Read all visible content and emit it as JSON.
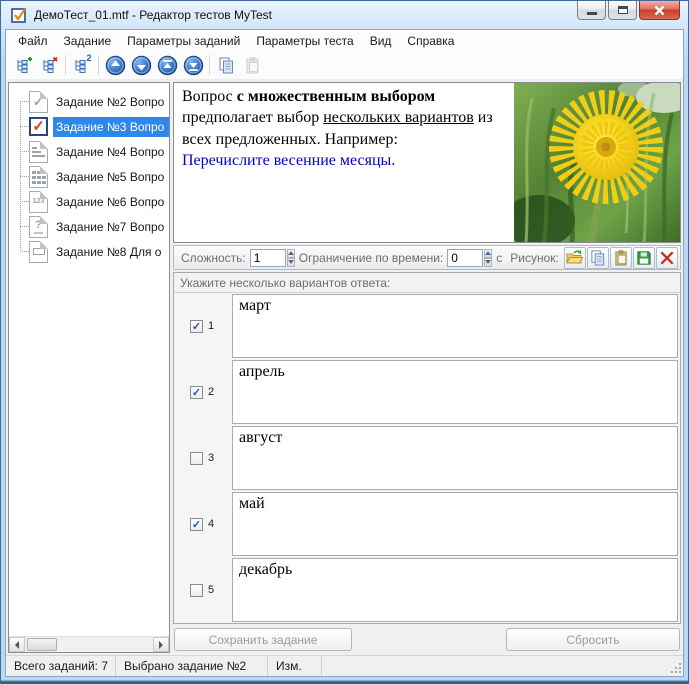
{
  "window": {
    "title": "ДемоТест_01.mtf - Редактор тестов MyTest"
  },
  "menu": {
    "items": [
      "Файл",
      "Задание",
      "Параметры заданий",
      "Параметры теста",
      "Вид",
      "Справка"
    ]
  },
  "toolbar": {
    "duplicate_badge": "2"
  },
  "tree": {
    "items": [
      {
        "label": "Задание №2 Вопро",
        "selected": false
      },
      {
        "label": "Задание №3 Вопро",
        "selected": true
      },
      {
        "label": "Задание №4 Вопро",
        "selected": false
      },
      {
        "label": "Задание №5 Вопро",
        "selected": false
      },
      {
        "label": "Задание №6 Вопро",
        "selected": false,
        "glyph": "123"
      },
      {
        "label": "Задание №7 Вопро",
        "selected": false,
        "glyph": "?"
      },
      {
        "label": "Задание №8 Для о",
        "selected": false
      }
    ]
  },
  "question": {
    "part_normal_1": "Вопрос ",
    "part_bold": "с множественным выбором",
    "part_normal_2": " предполагает выбор ",
    "part_underline": "нескольких вариантов",
    "part_normal_3": " из всех предложенных. Например:",
    "example_line": "Перечислите весенние месяцы.",
    "image": "dandelion-photo"
  },
  "params": {
    "difficulty_label": "Сложность:",
    "difficulty_value": "1",
    "time_label": "Ограничение по времени:",
    "time_value": "0",
    "time_unit": "с",
    "picture_label": "Рисунок:"
  },
  "answers": {
    "header": "Укажите несколько вариантов ответа:",
    "items": [
      {
        "num": "1",
        "text": "март",
        "check": "✓"
      },
      {
        "num": "2",
        "text": "апрель",
        "check": "✓"
      },
      {
        "num": "3",
        "text": "август",
        "check": ""
      },
      {
        "num": "4",
        "text": "май",
        "check": "✓"
      },
      {
        "num": "5",
        "text": "декабрь",
        "check": ""
      }
    ]
  },
  "footer": {
    "save_label": "Сохранить задание",
    "reset_label": "Сбросить"
  },
  "statusbar": {
    "total": "Всего заданий: 7",
    "selected": "Выбрано задание №2",
    "modified": "Изм."
  },
  "colors": {
    "accent_selection": "#2e87ea",
    "close_button": "#c83f28",
    "example_text": "#0000cd"
  }
}
